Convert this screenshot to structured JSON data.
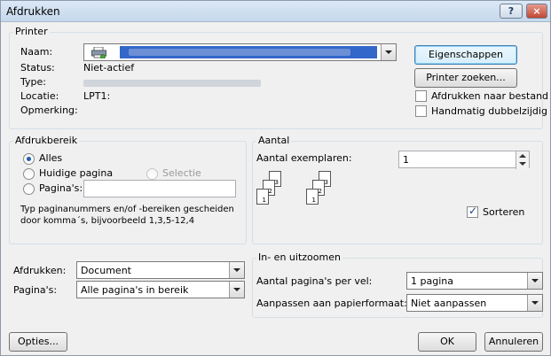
{
  "window": {
    "title": "Afdrukken",
    "help": "?",
    "close": "×"
  },
  "printer": {
    "group_label": "Printer",
    "name_label": "Naam:",
    "status_label": "Status:",
    "status_value": "Niet-actief",
    "type_label": "Type:",
    "location_label": "Locatie:",
    "location_value": "LPT1:",
    "comment_label": "Opmerking:",
    "properties_button": "Eigenschappen",
    "find_printer_button": "Printer zoeken...",
    "print_to_file": "Afdrukken naar bestand",
    "manual_duplex": "Handmatig dubbelzijdig"
  },
  "range": {
    "group_label": "Afdrukbereik",
    "all": "Alles",
    "current": "Huidige pagina",
    "selection": "Selectie",
    "pages": "Pagina's:",
    "hint_line1": "Typ paginanummers en/of -bereiken gescheiden",
    "hint_line2": "door komma´s, bijvoorbeeld 1,3,5-12,4"
  },
  "copies": {
    "group_label": "Aantal",
    "count_label": "Aantal exemplaren:",
    "count_value": "1",
    "collate": "Sorteren"
  },
  "zoom": {
    "group_label": "In- en uitzoomen",
    "per_sheet_label": "Aantal pagina's per vel:",
    "per_sheet_value": "1 pagina",
    "scale_label": "Aanpassen aan papierformaat:",
    "scale_value": "Niet aanpassen"
  },
  "print_what": {
    "label": "Afdrukken:",
    "value": "Document"
  },
  "print_pages": {
    "label": "Pagina's:",
    "value": "Alle pagina's in bereik"
  },
  "footer": {
    "options": "Opties...",
    "ok": "OK",
    "cancel": "Annuleren"
  },
  "collate_pages": [
    "1",
    "2",
    "3"
  ]
}
